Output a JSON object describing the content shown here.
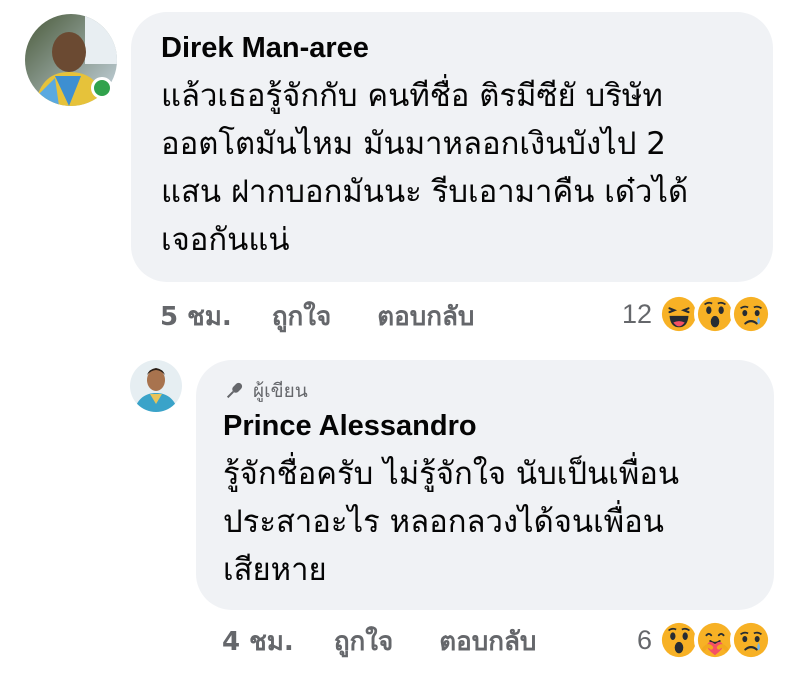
{
  "comment": {
    "author": "Direk Man-aree",
    "text_lines": [
      "แล้วเธอรู้จักกับ คนทีชื่อ ติรมีซียั บริษัท",
      "ออตโตมันไหม  มันมาหลอกเงินบังไป 2",
      "แสน ฝากบอกมันนะ รีบเอามาคืน เด๋วได้",
      "เจอกันแน่"
    ],
    "time": "5 ชม.",
    "like_label": "ถูกใจ",
    "reply_label": "ตอบกลับ",
    "reaction_count": "12",
    "reactions": [
      "haha-icon",
      "wow-icon",
      "sad-icon"
    ],
    "online": true,
    "online_color": "#31a24c"
  },
  "reply": {
    "badge_icon": "microphone-icon",
    "badge_label": "ผู้เขียน",
    "author": "Prince Alessandro",
    "text_lines": [
      "รู้จักชื่อครับ ไม่รู้จักใจ  นับเป็นเพื่อน",
      "ประสาอะไร หลอกลวงได้จนเพื่อน",
      "เสียหาย"
    ],
    "time": "4 ชม.",
    "like_label": "ถูกใจ",
    "reply_label": "ตอบกลับ",
    "reaction_count": "6",
    "reactions": [
      "wow-icon",
      "care-icon",
      "sad-icon"
    ]
  },
  "colors": {
    "bubble_bg": "#f0f2f5",
    "meta_text": "#65676b",
    "reaction_yellow": "#f7b125"
  }
}
